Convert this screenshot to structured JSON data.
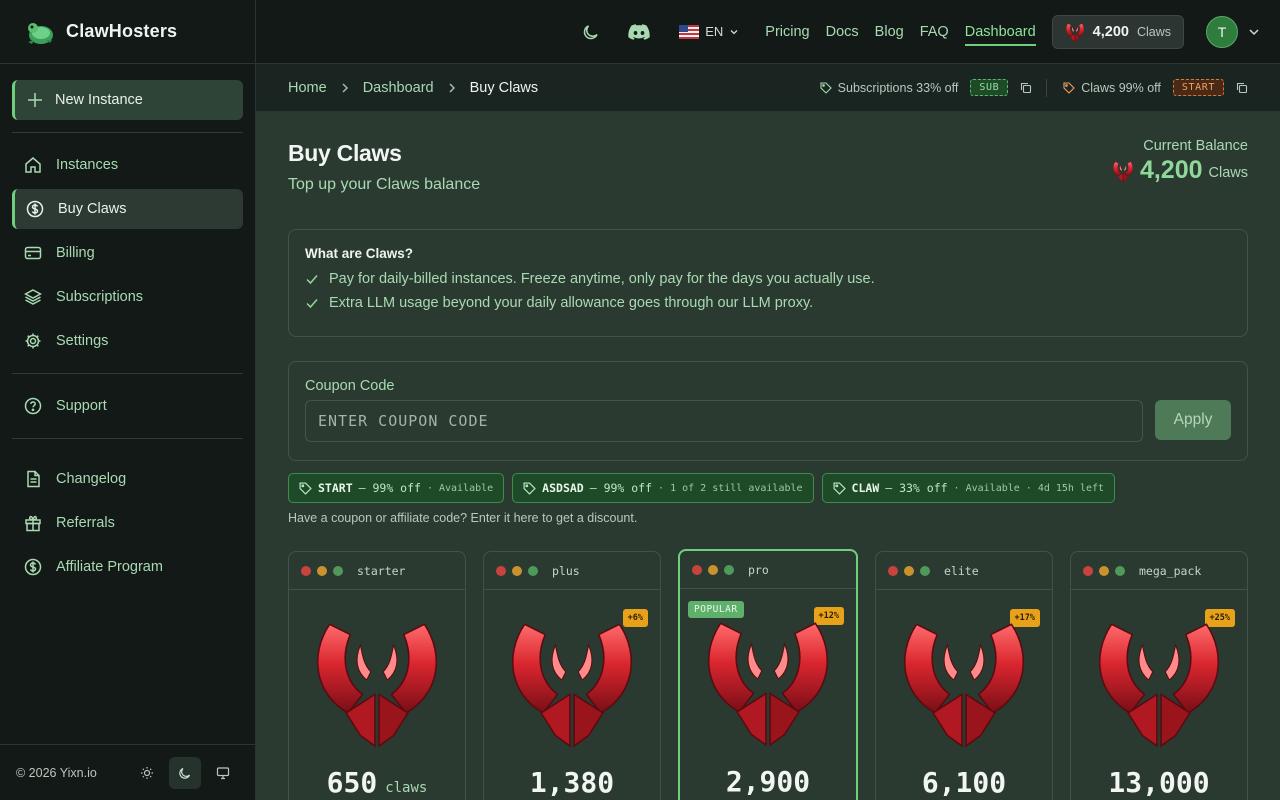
{
  "app": {
    "name": "ClawHosters"
  },
  "sidebar": {
    "new_instance": "New Instance",
    "nav_primary": [
      {
        "label": "Instances",
        "icon": "home-icon"
      },
      {
        "label": "Buy Claws",
        "icon": "dollar-circle-icon",
        "active": true
      },
      {
        "label": "Billing",
        "icon": "credit-card-icon"
      },
      {
        "label": "Subscriptions",
        "icon": "layers-icon"
      },
      {
        "label": "Settings",
        "icon": "gear-icon"
      }
    ],
    "support": "Support",
    "nav_secondary": [
      {
        "label": "Changelog",
        "icon": "document-icon"
      },
      {
        "label": "Referrals",
        "icon": "gift-icon"
      },
      {
        "label": "Affiliate Program",
        "icon": "dollar-circle-icon"
      }
    ],
    "footer_text": "© 2026 Yixn.io",
    "theme_active": "dark"
  },
  "topbar": {
    "language": "EN",
    "links": [
      "Pricing",
      "Docs",
      "Blog",
      "FAQ",
      "Dashboard"
    ],
    "active_link": "Dashboard",
    "balance_value": "4,200",
    "balance_unit": "Claws",
    "avatar_initial": "T"
  },
  "breadcrumb": {
    "items": [
      "Home",
      "Dashboard",
      "Buy Claws"
    ],
    "promos": [
      {
        "text": "Subscriptions 33% off",
        "code": "SUB",
        "color": "#58b868"
      },
      {
        "text": "Claws 99% off",
        "code": "START",
        "color": "#d27a3c"
      }
    ]
  },
  "page": {
    "title": "Buy Claws",
    "subtitle": "Top up your Claws balance",
    "balance_label": "Current Balance",
    "balance_value": "4,200",
    "balance_unit": "Claws"
  },
  "info": {
    "heading": "What are Claws?",
    "points": [
      "Pay for daily-billed instances. Freeze anytime, only pay for the days you actually use.",
      "Extra LLM usage beyond your daily allowance goes through our LLM proxy."
    ]
  },
  "coupon": {
    "label": "Coupon Code",
    "placeholder": "ENTER COUPON CODE",
    "value": "",
    "apply": "Apply",
    "chips": [
      {
        "code": "START",
        "discount": "— 99% off",
        "meta": "· Available"
      },
      {
        "code": "ASDSAD",
        "discount": "— 99% off",
        "meta": "· 1 of 2 still available"
      },
      {
        "code": "CLAW",
        "discount": "— 33% off",
        "meta": "· Available · 4d 15h left"
      }
    ],
    "hint": "Have a coupon or affiliate code? Enter it here to get a discount."
  },
  "packs": [
    {
      "name": "starter",
      "amount": "650",
      "unit": "claws",
      "bonus": "",
      "popular": false
    },
    {
      "name": "plus",
      "amount": "1,380",
      "unit": "",
      "bonus": "+6%",
      "popular": false
    },
    {
      "name": "pro",
      "amount": "2,900",
      "unit": "",
      "bonus": "+12%",
      "popular": true,
      "badge": "POPULAR"
    },
    {
      "name": "elite",
      "amount": "6,100",
      "unit": "",
      "bonus": "+17%",
      "popular": false
    },
    {
      "name": "mega_pack",
      "amount": "13,000",
      "unit": "",
      "bonus": "+25%",
      "popular": false
    }
  ],
  "colors": {
    "accent": "#6fcf7d",
    "claw": "#d32a33",
    "bonus": "#e8a21a"
  }
}
